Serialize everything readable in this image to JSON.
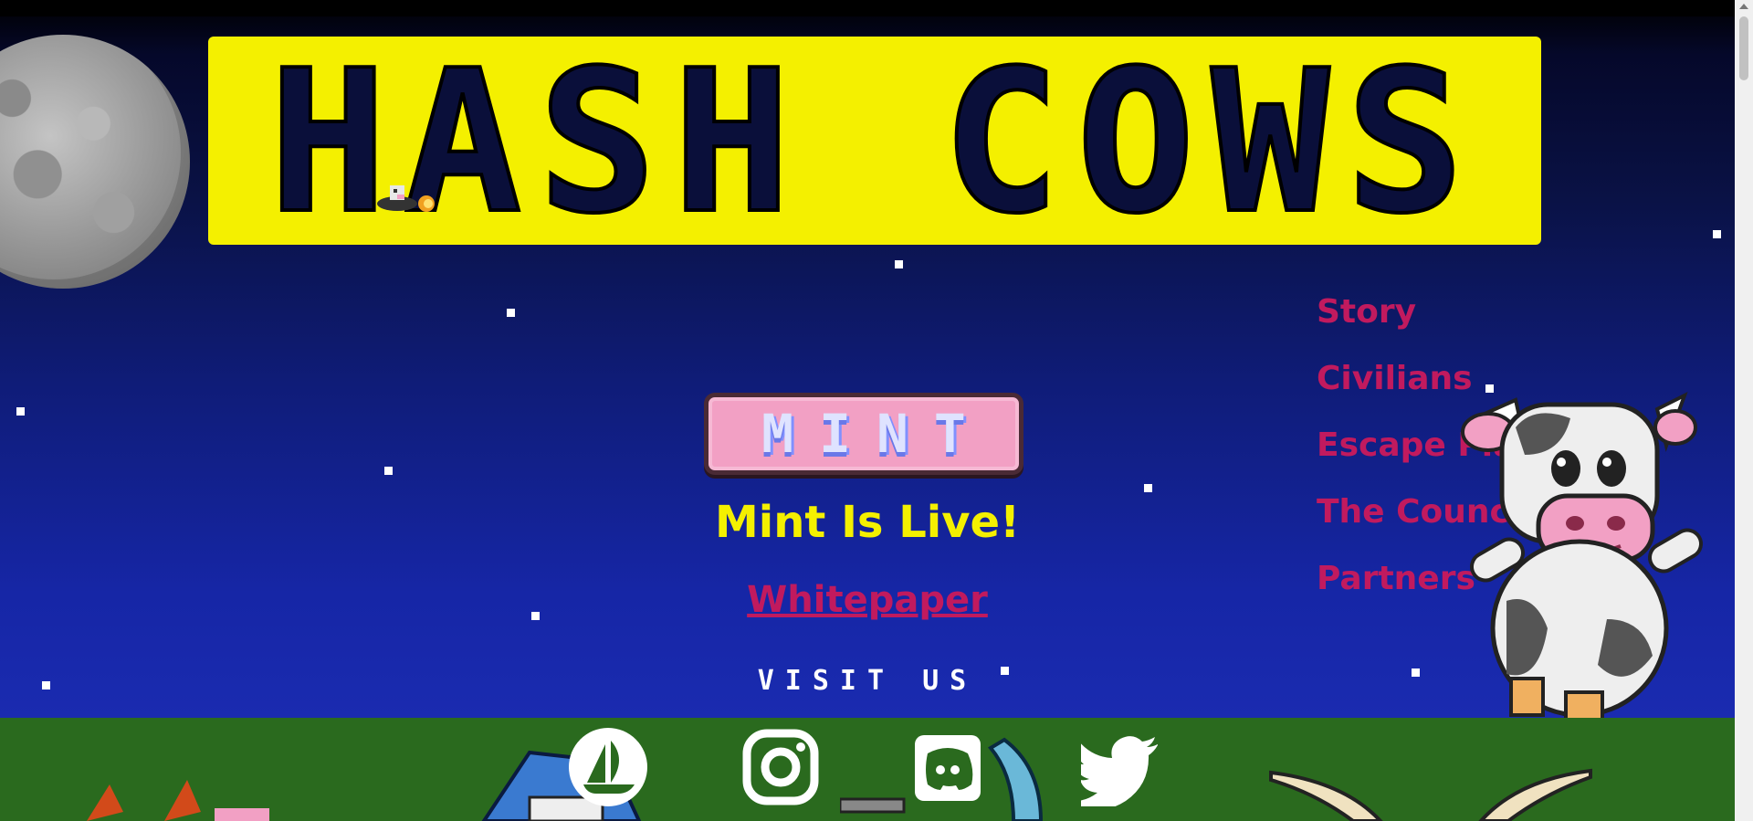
{
  "brand": {
    "logo_text": "HASH COWS",
    "accent_color": "#f4f000",
    "link_color": "#c11a5e"
  },
  "main": {
    "mint_button_label": "MINT",
    "status_text": "Mint Is Live!",
    "whitepaper_link": "Whitepaper",
    "visit_us_text": "VISIT US"
  },
  "nav": {
    "items": [
      {
        "label": "Story"
      },
      {
        "label": "Civilians"
      },
      {
        "label": "Escape Plan"
      },
      {
        "label": "The Council"
      },
      {
        "label": "Partners"
      }
    ]
  },
  "social": {
    "links": [
      {
        "icon": "opensea-icon"
      },
      {
        "icon": "instagram-icon"
      },
      {
        "icon": "discord-icon"
      },
      {
        "icon": "twitter-icon"
      }
    ]
  }
}
